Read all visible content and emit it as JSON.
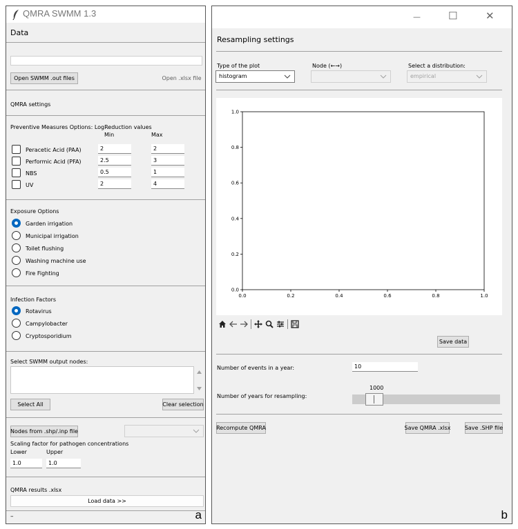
{
  "left_panel": {
    "app_title": "QMRA SWMM 1.3",
    "data_heading": "Data",
    "path_value": "",
    "open_out_button": "Open SWMM .out files",
    "open_xlsx_button": "Open .xlsx file",
    "qmra_settings_label": "QMRA settings",
    "preventive": {
      "title": "Preventive Measures Options: LogReduction values",
      "min_header": "Min",
      "max_header": "Max",
      "measures": [
        {
          "label": "Peracetic Acid (PAA)",
          "min": "2",
          "max": "2"
        },
        {
          "label": "Performic Acid (PFA)",
          "min": "2.5",
          "max": "3"
        },
        {
          "label": "NBS",
          "min": "0.5",
          "max": "1"
        },
        {
          "label": "UV",
          "min": "2",
          "max": "4"
        }
      ]
    },
    "exposure": {
      "title": "Exposure Options",
      "options": [
        "Garden irrigation",
        "Municipal irrigation",
        "Toilet flushing",
        "Washing machine use",
        "Fire Fighting"
      ],
      "selected": "Garden irrigation"
    },
    "infection": {
      "title": "Infection Factors",
      "options": [
        "Rotavirus",
        "Campylobacter",
        "Cryptosporidium"
      ],
      "selected": "Rotavirus"
    },
    "nodes_label": "Select SWMM output nodes:",
    "select_all_button": "Select All",
    "clear_selection_button": "Clear selection",
    "nodes_from_button": "Nodes from .shp/.inp file",
    "scaling_label": "Scaling factor for pathogen concentrations",
    "lower_label": "Lower",
    "upper_label": "Upper",
    "lower_value": "1.0",
    "upper_value": "1.0",
    "results_label": "QMRA results .xlsx",
    "load_data_button": "Load data >>",
    "bottom_dash": "–",
    "panel_letter": "a"
  },
  "right_panel": {
    "window_controls": {
      "minimize": "—",
      "maximize": "☐",
      "close": "✕"
    },
    "heading": "Resampling settings",
    "type_label": "Type of the plot",
    "type_value": "histogram",
    "node_label": "Node (←→)",
    "node_value": "",
    "dist_label": "Select a distribution:",
    "dist_value": "empirical",
    "toolbar_icons": [
      "home-icon",
      "back-icon",
      "forward-icon",
      "pan-icon",
      "zoom-icon",
      "configure-icon",
      "save-icon"
    ],
    "save_data_button": "Save data",
    "events_label": "Number of events in a year:",
    "events_value": "10",
    "years_label": "Number of years for resampling:",
    "years_value": "1000",
    "recompute_button": "Recompute QMRA",
    "save_qmra_button": "Save QMRA .xlsx",
    "save_shp_button": "Save .SHP file",
    "panel_letter": "b"
  },
  "chart_data": {
    "type": "histogram",
    "title": "",
    "xlabel": "",
    "ylabel": "",
    "xlim": [
      0.0,
      1.0
    ],
    "ylim": [
      0.0,
      1.0
    ],
    "x_ticks": [
      "0.0",
      "0.2",
      "0.4",
      "0.6",
      "0.8",
      "1.0"
    ],
    "y_ticks": [
      "0.0",
      "0.2",
      "0.4",
      "0.6",
      "0.8",
      "1.0"
    ],
    "values": []
  }
}
